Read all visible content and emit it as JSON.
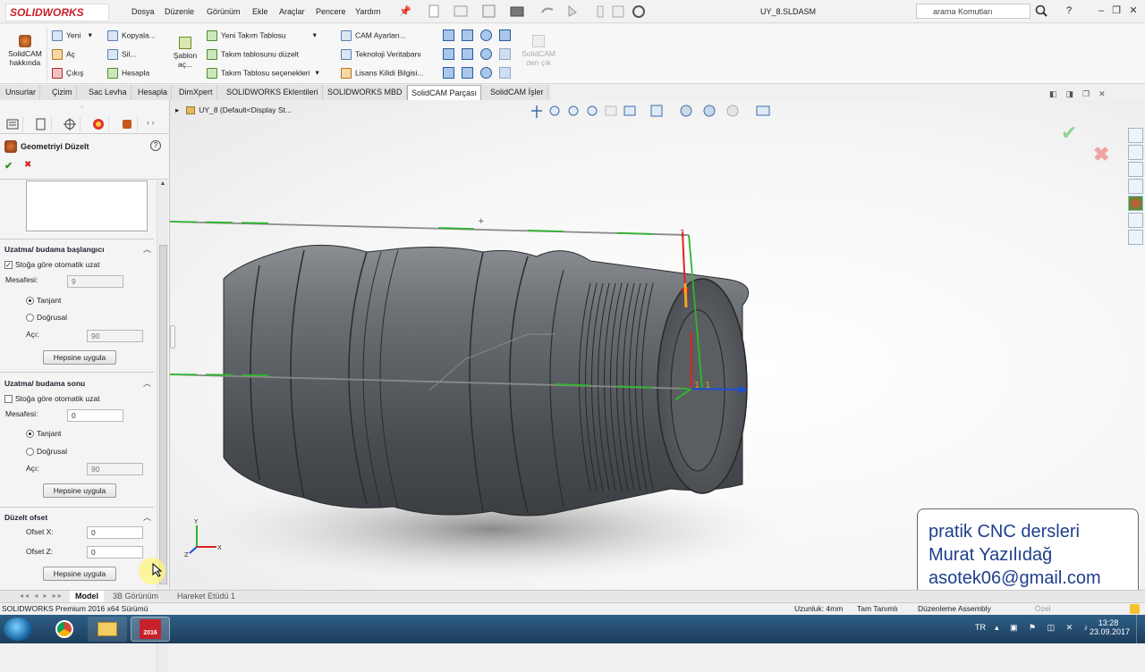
{
  "app": {
    "logo_text": "SOLIDWORKS",
    "doc_title": "UY_8.SLDASM",
    "search_placeholder": "arama Komutları",
    "help_label": "?"
  },
  "menu": [
    "Dosya",
    "Düzenle",
    "Görünüm",
    "Ekle",
    "Araçlar",
    "Pencere",
    "Yardım"
  ],
  "ribbon": {
    "solidcam_about": [
      "SolidCAM",
      "hakkında"
    ],
    "col1": [
      "Yeni",
      "Aç",
      "Çıkış"
    ],
    "col2": [
      "Kopyala...",
      "Sil...",
      "Hesapla"
    ],
    "sablon": [
      "Şablon",
      "aç..."
    ],
    "col3": [
      "Yeni Takım Tablosu",
      "Takım tablosunu düzelt",
      "Takım Tablosu seçenekleri"
    ],
    "col4": [
      "CAM Ayarları...",
      "Teknoloji Veritabanı",
      "Lisans Kilidi Bilgisi..."
    ],
    "solidcam_exit": [
      "SolidCAM",
      "den çık"
    ]
  },
  "command_tabs": [
    "Unsurlar",
    "Çizim",
    "Sac Levha",
    "Hesapla",
    "DimXpert",
    "SOLIDWORKS Eklentileri",
    "SOLIDWORKS MBD",
    "SolidCAM Parçası",
    "SolidCAM İşler"
  ],
  "command_tabs_active": "SolidCAM Parçası",
  "panel": {
    "title": "Geometriyi Düzelt",
    "ok": "✔",
    "cancel": "✖",
    "start_section": {
      "title": "Uzatma/ budama başlangıcı",
      "auto_label": "Stoğa göre otomatik uzat",
      "auto_checked": true,
      "distance_label": "Mesafesi:",
      "distance_value": "9",
      "tangent": "Tanjant",
      "linear": "Doğrusal",
      "angle_label": "Açı:",
      "angle_value": "90",
      "apply": "Hepsine uygula"
    },
    "end_section": {
      "title": "Uzatma/ budama sonu",
      "auto_label": "Stoğa göre otomatik uzat",
      "auto_checked": false,
      "distance_label": "Mesafesi:",
      "distance_value": "0",
      "tangent": "Tanjant",
      "linear": "Doğrusal",
      "angle_label": "Açı:",
      "angle_value": "90",
      "apply": "Hepsine uygula"
    },
    "offset_section": {
      "title": "Düzelt ofset",
      "x_label": "Ofset X:",
      "x_value": "0",
      "z_label": "Ofset Z:",
      "z_value": "0",
      "apply": "Hepsine uygula"
    }
  },
  "viewport": {
    "breadcrumb": "UY_8  (Default<Display St...",
    "point_labels": [
      "1",
      "1",
      "1"
    ],
    "axis_labels": [
      "X",
      "Y",
      "Z"
    ]
  },
  "bottom_tabs": [
    "Model",
    "3B Görünüm",
    "Hareket Etüdü 1"
  ],
  "bottom_tabs_active": "Model",
  "status": {
    "version": "SOLIDWORKS Premium 2016 x64 Sürümü",
    "length": "Uzunluk: 4mm",
    "defined": "Tam Tanımlı",
    "mode": "Düzenleme Assembly",
    "custom": "Özel"
  },
  "taskbar": {
    "lang": "TR",
    "time": "13:28",
    "date": "23.09.2017",
    "sw_badge": "2016"
  },
  "promo": {
    "line1": "pratik CNC dersleri",
    "line2": "Murat Yazılıdağ",
    "line3": "asotek06@gmail.com"
  },
  "colors": {
    "accent_red": "#c8202a",
    "taskbar": "#1c3d5c",
    "promo_text": "#1f3f8c",
    "model_gray": "#5b5f63",
    "edge_green": "#2fb52f"
  }
}
